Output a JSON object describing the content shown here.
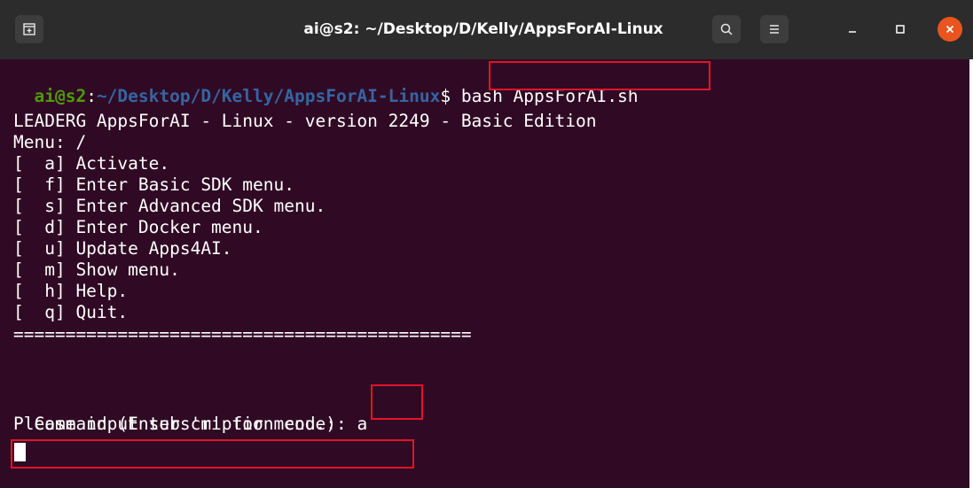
{
  "window": {
    "title": "ai@s2: ~/Desktop/D/Kelly/AppsForAI-Linux"
  },
  "icons": {
    "new_tab": "new-tab-icon",
    "search": "search-icon",
    "menu": "hamburger-menu-icon",
    "minimize": "minimize-icon",
    "maximize": "maximize-icon",
    "close": "close-icon"
  },
  "colors": {
    "background": "#300a24",
    "prompt_user": "#4e9a06",
    "prompt_path": "#3465a4",
    "highlight": "#e0142a"
  },
  "terminal": {
    "prompt_user": "ai@s2",
    "prompt_sep": ":",
    "prompt_path": "~/Desktop/D/Kelly/AppsForAI-Linux",
    "prompt_symbol": "$",
    "command": " bash AppsForAI.sh",
    "header": "LEADERG AppsForAI - Linux - version 2249 - Basic Edition",
    "menu_label": "Menu: /",
    "menu_items": [
      "[  a] Activate.",
      "[  f] Enter Basic SDK menu.",
      "[  s] Enter Advanced SDK menu.",
      "[  d] Enter Docker menu.",
      "[  u] Update Apps4AI.",
      "[  m] Show menu.",
      "[  h] Help.",
      "[  q] Quit."
    ],
    "separator": "============================================",
    "command_prompt": "Command (Enter 'm' for menu.)",
    "command_colon": ":",
    "command_input": " a",
    "subscription_prompt": "Please input subscription code:"
  }
}
